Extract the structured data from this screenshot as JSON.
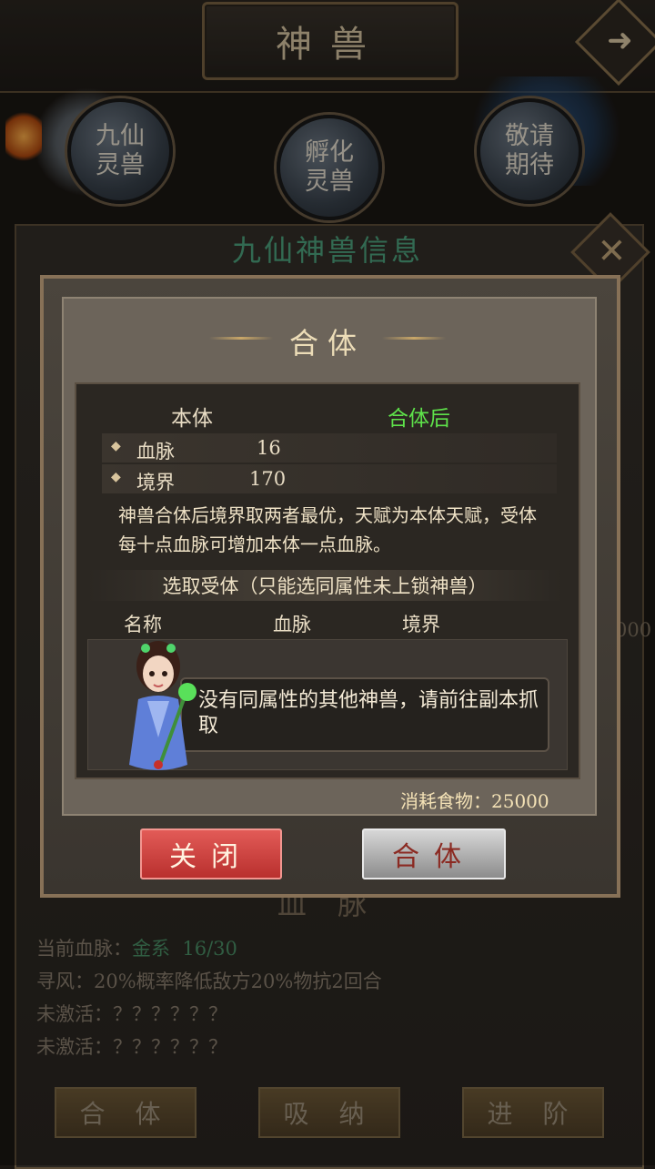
{
  "header": {
    "title": "神兽",
    "next_arrow": "arrow-right-icon"
  },
  "nav": [
    {
      "label": "九仙\n灵兽"
    },
    {
      "label": "孵化\n灵兽"
    },
    {
      "label": "敬请\n期待"
    }
  ],
  "info_panel": {
    "title": "九仙神兽信息",
    "close_glyph": "✕",
    "side_number": "000",
    "bloodline_heading": "血 脉",
    "bloodline_line": {
      "label": "当前血脉：",
      "element": "金系",
      "value": "16/30"
    },
    "skill_line": "寻风：20%概率降低敌方20%物抗2回合",
    "inactive_1": "未激活：？？？？？？",
    "inactive_2": "未激活：？？？？？？",
    "buttons": [
      "合 体",
      "吸 纳",
      "进 阶"
    ]
  },
  "dialog": {
    "title": "合体",
    "col_self": "本体",
    "col_after": "合体后",
    "stats": [
      {
        "label": "血脉",
        "value": "16"
      },
      {
        "label": "境界",
        "value": "170"
      }
    ],
    "description": "神兽合体后境界取两者最优，天赋为本体天赋，受体每十点血脉可增加本体一点血脉。",
    "select_title": "选取受体（只能选同属性未上锁神兽）",
    "list_headers": [
      "名称",
      "血脉",
      "境界"
    ],
    "empty_message": "没有同属性的其他神兽，请前往副本抓取",
    "cost": "消耗食物：25000",
    "close_button": "关闭",
    "merge_button": "合体"
  },
  "colors": {
    "accent_green": "#5ee24a",
    "close_red": "#c8403d",
    "panel_title_green": "#4ea47e"
  }
}
